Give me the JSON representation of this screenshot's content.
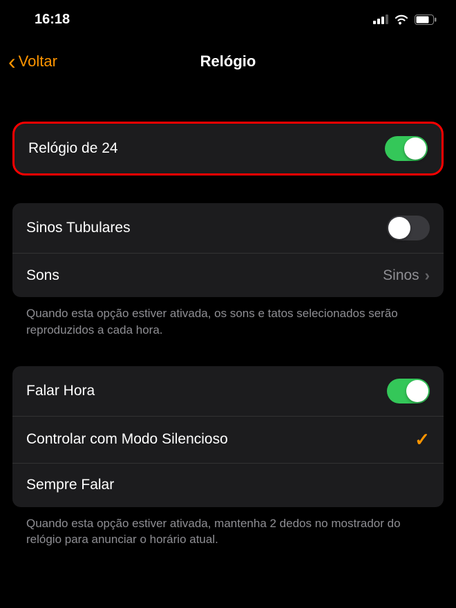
{
  "statusBar": {
    "time": "16:18"
  },
  "nav": {
    "back": "Voltar",
    "title": "Relógio"
  },
  "section1": {
    "row1": {
      "label": "Relógio de 24",
      "toggleOn": true
    }
  },
  "section2": {
    "row1": {
      "label": "Sinos Tubulares",
      "toggleOn": false
    },
    "row2": {
      "label": "Sons",
      "value": "Sinos"
    },
    "footer": "Quando esta opção estiver ativada, os sons e tatos selecionados serão reproduzidos a cada hora."
  },
  "section3": {
    "row1": {
      "label": "Falar Hora",
      "toggleOn": true
    },
    "row2": {
      "label": "Controlar com Modo Silencioso",
      "checked": true
    },
    "row3": {
      "label": "Sempre Falar",
      "checked": false
    },
    "footer": "Quando esta opção estiver ativada, mantenha 2 dedos no mostrador do relógio para anunciar o horário atual."
  }
}
